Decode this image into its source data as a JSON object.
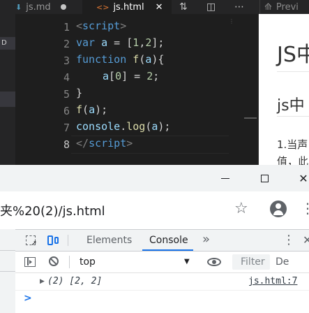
{
  "editor": {
    "tabs": [
      {
        "label": "js.md",
        "icon": "markdown-icon",
        "modified": true
      },
      {
        "label": "js.html",
        "icon": "html-icon",
        "active": true
      }
    ],
    "side_badge": "D",
    "preview_tab_label": "Previ",
    "line_numbers": [
      "1",
      "2",
      "3",
      "4",
      "5",
      "6",
      "7",
      "8"
    ],
    "active_line": "8",
    "minimap_label": "⋮",
    "code": {
      "l1": [
        "<",
        "script",
        ">"
      ],
      "l2": [
        "var",
        " ",
        "a",
        " = [",
        "1",
        ",",
        "2",
        "];"
      ],
      "l3": [
        "function",
        " ",
        "f",
        "(",
        "a",
        "){"
      ],
      "l4": [
        "a",
        "[",
        "0",
        "] = ",
        "2",
        ";"
      ],
      "l5": [
        "}"
      ],
      "l6": [
        "f",
        "(",
        "a",
        ");"
      ],
      "l7": [
        "console",
        ".",
        "log",
        "(",
        "a",
        ");"
      ],
      "l8": [
        "</",
        "script",
        ">"
      ]
    },
    "syntax_colors": {
      "tag": "#569cd6",
      "keyword": "#569cd6",
      "variable": "#9cdcfe",
      "function": "#dcdcaa",
      "number": "#b5cea8"
    }
  },
  "preview": {
    "title": "JS中",
    "heading": "js中",
    "para_line1": "1.当声",
    "para_line2": "值，此"
  },
  "browser": {
    "url": "夹%20(2)/js.html",
    "window_controls": {
      "minimize": "minimize",
      "maximize": "maximize",
      "close": "✕"
    },
    "star_icon": "☆",
    "menu_icon": "⋮"
  },
  "devtools": {
    "tabs": {
      "elements": "Elements",
      "console": "Console",
      "more": "»"
    },
    "active_tab": "Console",
    "menu_icon": "⋮",
    "close_icon": "✕",
    "context": "top",
    "context_arrow": "▼",
    "filter_placeholder": "Filter",
    "levels_label": "De",
    "message": {
      "expand": "▶",
      "text": "(2) [2, 2]",
      "source": "js.html:7"
    },
    "prompt": ">",
    "accent_color": "#1a73e8"
  }
}
